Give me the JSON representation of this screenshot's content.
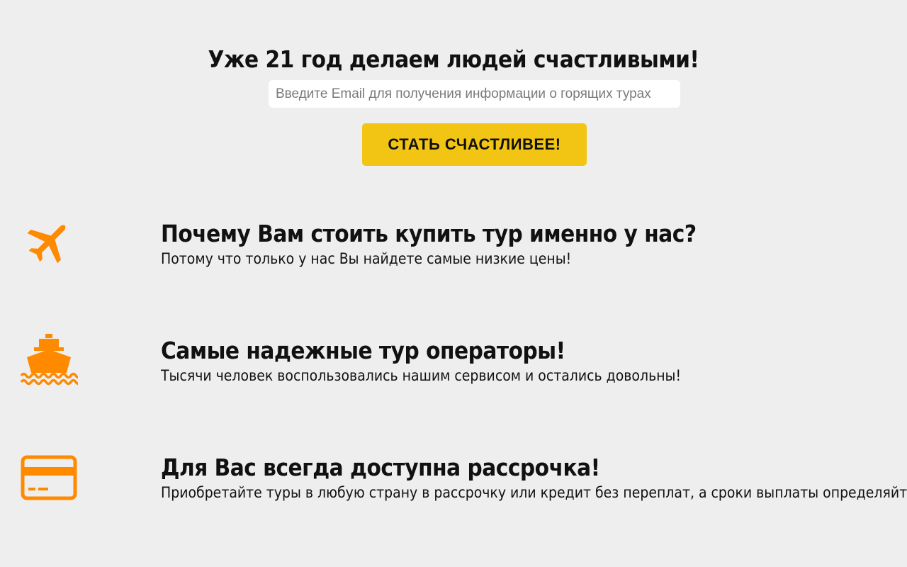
{
  "hero": {
    "title": "Уже 21 год делаем людей счастливыми!",
    "email_placeholder": "Введите Email для получения информации о горящих турах",
    "email_value": "",
    "cta_label": "СТАТЬ СЧАСТЛИВЕЕ!"
  },
  "features": [
    {
      "icon": "airplane-icon",
      "title": "Почему Вам стоить купить тур именно у нас?",
      "text": "Потому что только у нас Вы найдете самые низкие цены!"
    },
    {
      "icon": "ship-icon",
      "title": "Самые надежные тур операторы!",
      "text": "Тысячи человек воспользовались нашим сервисом и остались довольны!"
    },
    {
      "icon": "credit-card-icon",
      "title": "Для Вас всегда доступна рассрочка!",
      "text": "Приобретайте туры в любую страну в рассрочку или кредит без переплат, а сроки выплаты определяйте"
    }
  ],
  "colors": {
    "background": "#eeeeee",
    "accent_yellow": "#f2c413",
    "icon_orange": "#ff8a00"
  }
}
